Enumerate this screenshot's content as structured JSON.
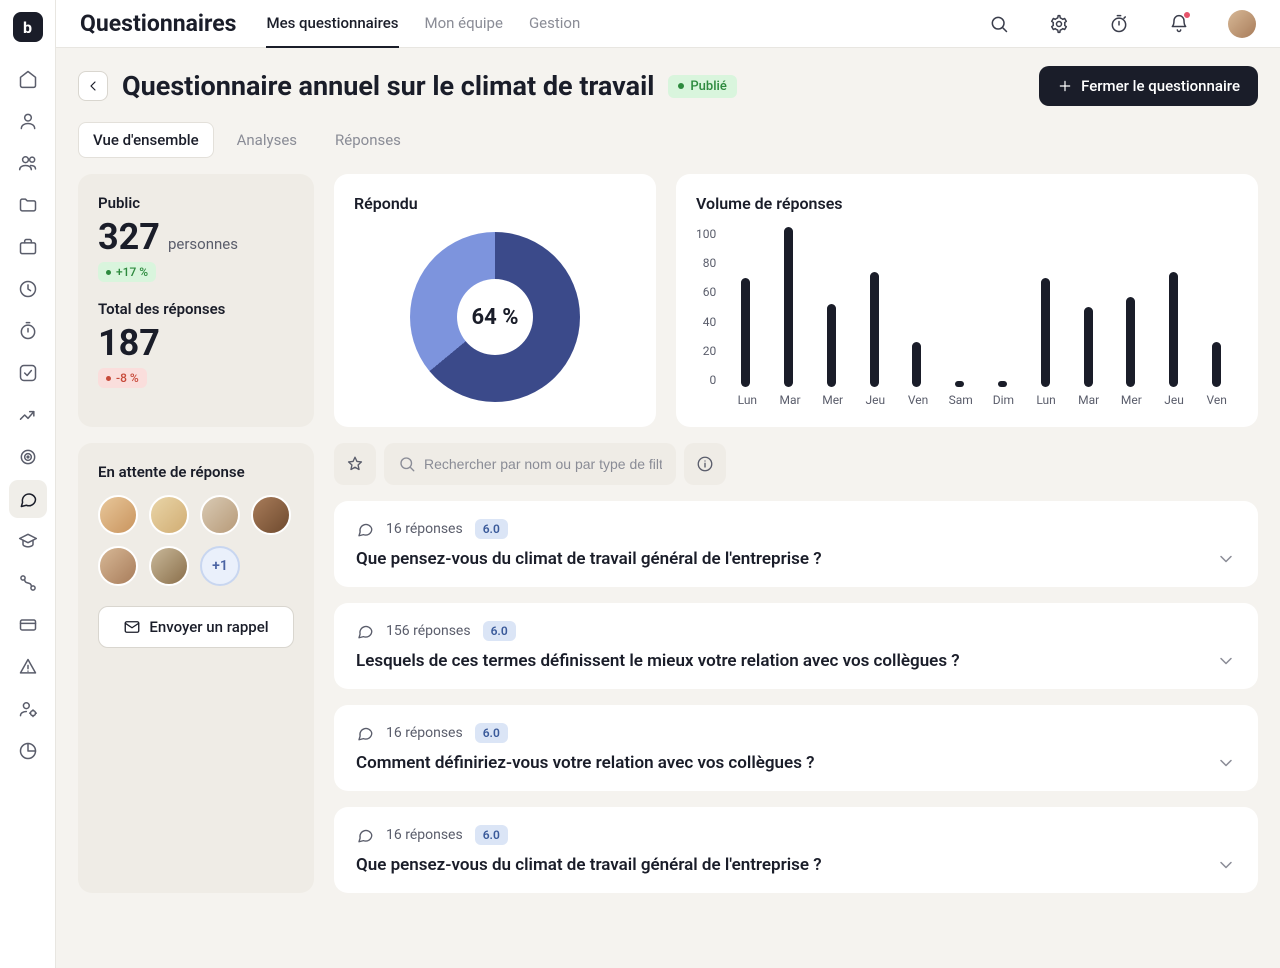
{
  "sidebar": {
    "logo_text": "b",
    "items": [
      "home",
      "user",
      "users",
      "folder",
      "briefcase",
      "clock",
      "stopwatch",
      "check",
      "trend",
      "target",
      "chat",
      "graduation",
      "flow",
      "card",
      "warning",
      "user-settings",
      "pie"
    ]
  },
  "topbar": {
    "title": "Questionnaires",
    "tabs": [
      {
        "label": "Mes questionnaires",
        "active": true
      },
      {
        "label": "Mon équipe",
        "active": false
      },
      {
        "label": "Gestion",
        "active": false
      }
    ]
  },
  "header": {
    "title": "Questionnaire annuel sur le climat de travail",
    "status": "Publié",
    "close_label": "Fermer le questionnaire"
  },
  "subtabs": [
    {
      "label": "Vue d'ensemble",
      "active": true
    },
    {
      "label": "Analyses",
      "active": false
    },
    {
      "label": "Réponses",
      "active": false
    }
  ],
  "stats": {
    "public_label": "Public",
    "public_value": "327",
    "public_unit": "personnes",
    "public_delta": "+17 %",
    "total_label": "Total des réponses",
    "total_value": "187",
    "total_delta": "-8 %"
  },
  "donut": {
    "title": "Répondu",
    "percent": 64,
    "center_text": "64 %",
    "colors": {
      "filled": "#3b4a8a",
      "remaining": "#7d94dd"
    }
  },
  "chart_data": {
    "type": "bar",
    "title": "Volume de réponses",
    "categories": [
      "Lun",
      "Mar",
      "Mer",
      "Jeu",
      "Ven",
      "Sam",
      "Dim",
      "Lun",
      "Mar",
      "Mer",
      "Jeu",
      "Ven"
    ],
    "values": [
      68,
      100,
      52,
      72,
      28,
      3,
      3,
      68,
      50,
      56,
      72,
      28
    ],
    "ylabel": "",
    "ylim": [
      0,
      100
    ],
    "yticks": [
      100,
      80,
      60,
      40,
      20,
      0
    ]
  },
  "awaiting": {
    "title": "En attente de réponse",
    "more_label": "+1",
    "send_label": "Envoyer un rappel"
  },
  "search": {
    "placeholder": "Rechercher par nom ou par type de filtre..."
  },
  "questions": [
    {
      "responses": "16 réponses",
      "score": "6.0",
      "text": "Que pensez-vous du climat de travail général de l'entreprise ?"
    },
    {
      "responses": "156 réponses",
      "score": "6.0",
      "text": "Lesquels de ces termes définissent le mieux votre relation avec vos collègues ?"
    },
    {
      "responses": "16 réponses",
      "score": "6.0",
      "text": "Comment définiriez-vous votre relation avec vos collègues ?"
    },
    {
      "responses": "16 réponses",
      "score": "6.0",
      "text": "Que pensez-vous du climat de travail général de l'entreprise ?"
    }
  ]
}
